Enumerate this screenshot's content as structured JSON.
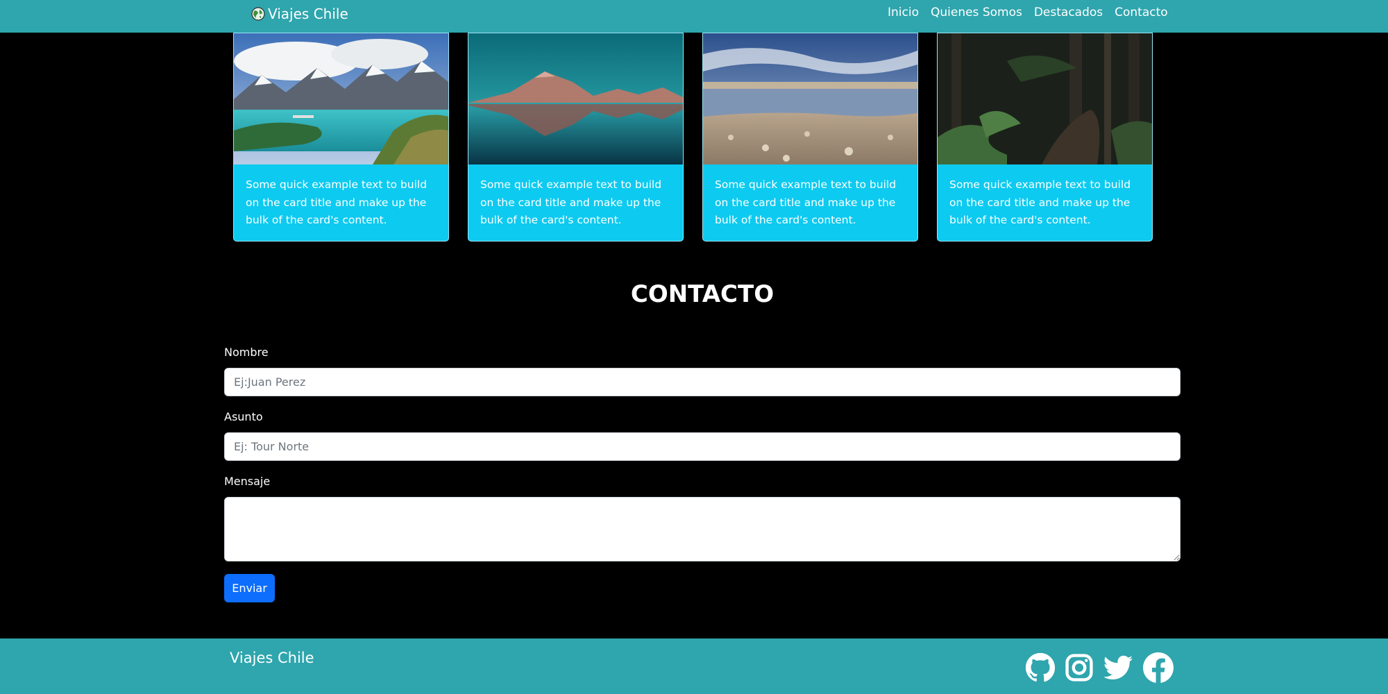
{
  "navbar": {
    "brand": "Viajes Chile",
    "logo_icon": "world-globe-icon",
    "links": [
      "Inicio",
      "Quienes Somos",
      "Destacados",
      "Contacto"
    ]
  },
  "cards": [
    {
      "image": "mountain-lake-photo",
      "text": "Some quick example text to build on the card title and make up the bulk of the card's content."
    },
    {
      "image": "volcano-reflection-photo",
      "text": "Some quick example text to build on the card title and make up the bulk of the card's content."
    },
    {
      "image": "salt-flat-lagoon-photo",
      "text": "Some quick example text to build on the card title and make up the bulk of the card's content."
    },
    {
      "image": "forest-trail-photo",
      "text": "Some quick example text to build on the card title and make up the bulk of the card's content."
    }
  ],
  "contact": {
    "title": "CONTACTO",
    "name_label": "Nombre",
    "name_placeholder": "Ej:Juan Perez",
    "subject_label": "Asunto",
    "subject_placeholder": "Ej: Tour Norte",
    "message_label": "Mensaje",
    "message_value": "",
    "submit_label": "Enviar"
  },
  "footer": {
    "brand": "Viajes Chile",
    "social_icons": [
      "github-icon",
      "instagram-icon",
      "twitter-icon",
      "facebook-icon"
    ]
  },
  "colors": {
    "navbar_bg": "#2fa5ad",
    "card_bg": "#0dcaf0",
    "button_bg": "#0d6efd",
    "page_bg": "#000000"
  }
}
